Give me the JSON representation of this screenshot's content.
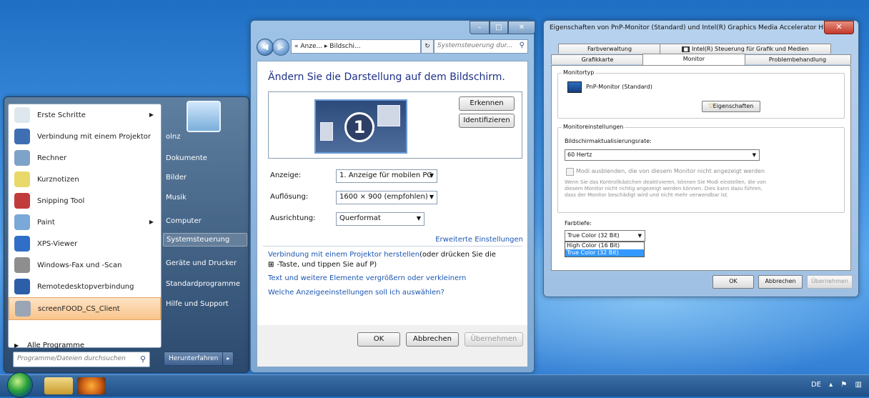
{
  "start_menu": {
    "programs": [
      {
        "label": "Erste Schritte",
        "icon": "getting-started-icon",
        "color": "#dfe7ee",
        "arrow": true
      },
      {
        "label": "Verbindung mit einem Projektor",
        "icon": "projector-icon",
        "color": "#3f6fb2",
        "arrow": false
      },
      {
        "label": "Rechner",
        "icon": "calculator-icon",
        "color": "#7ea3c9",
        "arrow": false
      },
      {
        "label": "Kurznotizen",
        "icon": "sticky-notes-icon",
        "color": "#e9d86a",
        "arrow": false
      },
      {
        "label": "Snipping Tool",
        "icon": "scissors-icon",
        "color": "#c23b3b",
        "arrow": false
      },
      {
        "label": "Paint",
        "icon": "paint-icon",
        "color": "#7aa8d8",
        "arrow": true
      },
      {
        "label": "XPS-Viewer",
        "icon": "xps-viewer-icon",
        "color": "#2f6fc7",
        "arrow": false
      },
      {
        "label": "Windows-Fax und -Scan",
        "icon": "fax-scan-icon",
        "color": "#8e8e8e",
        "arrow": false
      },
      {
        "label": "Remotedesktopverbindung",
        "icon": "remote-desktop-icon",
        "color": "#2d5ea8",
        "arrow": false
      },
      {
        "label": "screenFOOD_CS_Client",
        "icon": "screenfood-icon",
        "color": "#9aa6b5",
        "arrow": false
      }
    ],
    "all_programs": "Alle Programme",
    "search_placeholder": "Programme/Dateien durchsuchen",
    "right_items": [
      "olnz",
      "Dokumente",
      "Bilder",
      "Musik",
      "Computer",
      "Systemsteuerung",
      "Geräte und Drucker",
      "Standardprogramme",
      "Hilfe und Support"
    ],
    "shutdown": "Herunterfahren",
    "shutdown_arrow": "▸"
  },
  "display_window": {
    "breadcrumb": "« Anze... ▸ Bildschi...",
    "search_placeholder": "Systemsteuerung dur...",
    "heading": "Ändern Sie die Darstellung auf dem Bildschirm.",
    "monitor_number": "1",
    "detect_button": "Erkennen",
    "identify_button": "Identifizieren",
    "labels": {
      "display": "Anzeige:",
      "resolution": "Auflösung:",
      "orientation": "Ausrichtung:"
    },
    "values": {
      "display": "1. Anzeige für mobilen PC",
      "resolution": "1600 × 900 (empfohlen)",
      "orientation": "Querformat"
    },
    "advanced_link": "Erweiterte Einstellungen",
    "projector_link": "Verbindung mit einem Projektor herstellen",
    "projector_rest1": "(oder drücken Sie die",
    "projector_rest2": "-Taste, und tippen Sie auf P)",
    "textsize_link": "Text und weitere Elemente vergrößern oder verkleinern",
    "which_link": "Welche Anzeigeeinstellungen soll ich auswählen?",
    "ok": "OK",
    "cancel": "Abbrechen",
    "apply": "Übernehmen"
  },
  "properties_dialog": {
    "title": "Eigenschaften von PnP-Monitor (Standard) und Intel(R) Graphics Media Accelerator HD",
    "tabs_row1": [
      "Farbverwaltung",
      "Intel(R) Steuerung für Grafik und Medien"
    ],
    "tabs_row2": [
      "Grafikkarte",
      "Monitor",
      "Problembehandlung"
    ],
    "active_tab": "Monitor",
    "monitortype_group": "Monitortyp",
    "monitor_name": "PnP-Monitor (Standard)",
    "properties_button": "Eigenschaften",
    "settings_group": "Monitoreinstellungen",
    "refresh_label": "Bildschirmaktualisierungsrate:",
    "refresh_value": "60 Hertz",
    "hide_modes_label": "Modi ausblenden, die von diesem Monitor nicht angezeigt werden",
    "warning_text": "Wenn Sie das Kontrollkästchen deaktivieren, können Sie Modi einstellen, die von diesem Monitor nicht richtig angezeigt werden können. Dies kann dazu führen, dass der Monitor beschädigt wird und nicht mehr verwendbar ist.",
    "color_depth_label": "Farbtiefe:",
    "color_depth_value": "True Color (32 Bit)",
    "color_options": [
      "High Color (16 Bit)",
      "True Color (32 Bit)"
    ],
    "ok": "OK",
    "cancel": "Abbrechen",
    "apply": "Übernehmen"
  },
  "taskbar": {
    "language": "DE",
    "tray_arrow": "▴"
  }
}
